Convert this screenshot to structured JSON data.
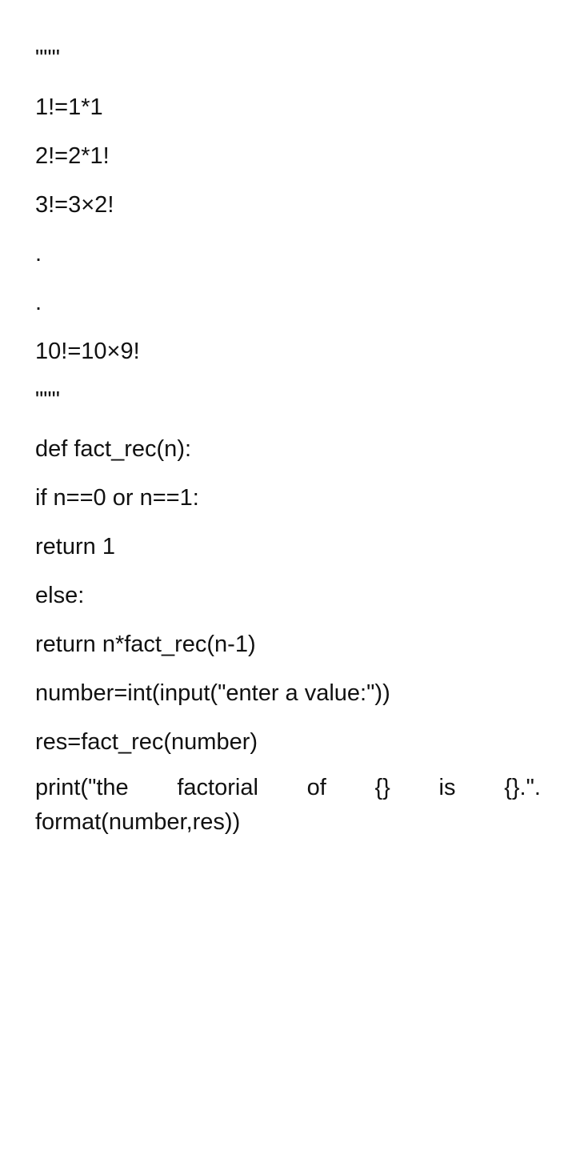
{
  "document": {
    "lines": [
      "\"\"\"",
      "1!=1*1",
      "2!=2*1!",
      "3!=3×2!",
      ".",
      ".",
      "10!=10×9!",
      "\"\"\"",
      "def fact_rec(n):",
      "if n==0 or n==1:",
      "return 1",
      "else:",
      "return n*fact_rec(n-1)",
      "number=int(input(\"enter a value:\"))",
      "res=fact_rec(number)"
    ],
    "last_line_words": [
      "print(\"the",
      "factorial",
      "of",
      "{}",
      "is",
      "{}.\"."
    ],
    "last_line_continuation": "format(number,res))"
  }
}
